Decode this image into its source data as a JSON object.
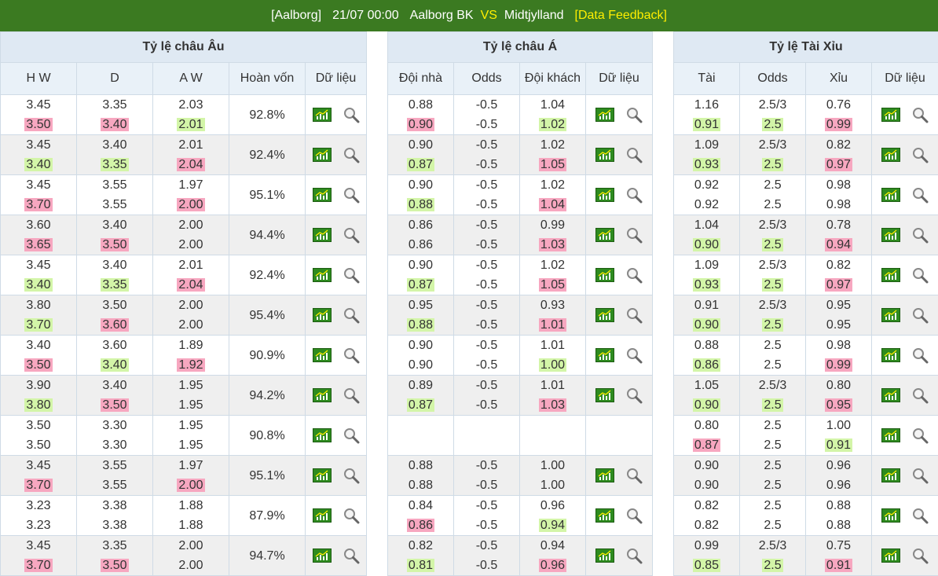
{
  "header": {
    "league": "[Aalborg]",
    "datetime": "21/07 00:00",
    "home": "Aalborg BK",
    "vs": "VS",
    "away": "Midtjylland",
    "feedback": "[Data Feedback]"
  },
  "colors": {
    "header_bg": "#3b7a21",
    "accent": "#ffee00",
    "up": "#f7a7c0",
    "down": "#d3f5a8"
  },
  "icons": {
    "chart": "chart-icon",
    "search": "search-icon"
  },
  "sections": [
    {
      "key": "eu",
      "title": "Tỷ lệ châu Âu",
      "columns": [
        "H W",
        "D",
        "A W",
        "Hoàn vốn",
        "Dữ liệu"
      ],
      "rows": [
        [
          [
            "3.45",
            "3.50",
            "r"
          ],
          [
            "3.35",
            "3.40",
            "r"
          ],
          [
            "2.03",
            "2.01",
            "g"
          ],
          [
            "92.8%"
          ]
        ],
        [
          [
            "3.45",
            "3.40",
            "g"
          ],
          [
            "3.40",
            "3.35",
            "g"
          ],
          [
            "2.01",
            "2.04",
            "r"
          ],
          [
            "92.4%"
          ]
        ],
        [
          [
            "3.45",
            "3.70",
            "r"
          ],
          [
            "3.55",
            "3.55",
            ""
          ],
          [
            "1.97",
            "2.00",
            "r"
          ],
          [
            "95.1%"
          ]
        ],
        [
          [
            "3.60",
            "3.65",
            "r"
          ],
          [
            "3.40",
            "3.50",
            "r"
          ],
          [
            "2.00",
            "2.00",
            ""
          ],
          [
            "94.4%"
          ]
        ],
        [
          [
            "3.45",
            "3.40",
            "g"
          ],
          [
            "3.40",
            "3.35",
            "g"
          ],
          [
            "2.01",
            "2.04",
            "r"
          ],
          [
            "92.4%"
          ]
        ],
        [
          [
            "3.80",
            "3.70",
            "g"
          ],
          [
            "3.50",
            "3.60",
            "r"
          ],
          [
            "2.00",
            "2.00",
            ""
          ],
          [
            "95.4%"
          ]
        ],
        [
          [
            "3.40",
            "3.50",
            "r"
          ],
          [
            "3.60",
            "3.40",
            "g"
          ],
          [
            "1.89",
            "1.92",
            "r"
          ],
          [
            "90.9%"
          ]
        ],
        [
          [
            "3.90",
            "3.80",
            "g"
          ],
          [
            "3.40",
            "3.50",
            "r"
          ],
          [
            "1.95",
            "1.95",
            ""
          ],
          [
            "94.2%"
          ]
        ],
        [
          [
            "3.50",
            "3.50",
            ""
          ],
          [
            "3.30",
            "3.30",
            ""
          ],
          [
            "1.95",
            "1.95",
            ""
          ],
          [
            "90.8%"
          ]
        ],
        [
          [
            "3.45",
            "3.70",
            "r"
          ],
          [
            "3.55",
            "3.55",
            ""
          ],
          [
            "1.97",
            "2.00",
            "r"
          ],
          [
            "95.1%"
          ]
        ],
        [
          [
            "3.23",
            "3.23",
            ""
          ],
          [
            "3.38",
            "3.38",
            ""
          ],
          [
            "1.88",
            "1.88",
            ""
          ],
          [
            "87.9%"
          ]
        ],
        [
          [
            "3.45",
            "3.70",
            "r"
          ],
          [
            "3.35",
            "3.50",
            "r"
          ],
          [
            "2.00",
            "2.00",
            ""
          ],
          [
            "94.7%"
          ]
        ]
      ]
    },
    {
      "key": "asia",
      "title": "Tỷ lệ châu Á",
      "columns": [
        "Đội nhà",
        "Odds",
        "Đội khách",
        "Dữ liệu"
      ],
      "rows": [
        [
          [
            "0.88",
            "0.90",
            "r"
          ],
          [
            "-0.5",
            "-0.5",
            ""
          ],
          [
            "1.04",
            "1.02",
            "g"
          ]
        ],
        [
          [
            "0.90",
            "0.87",
            "g"
          ],
          [
            "-0.5",
            "-0.5",
            ""
          ],
          [
            "1.02",
            "1.05",
            "r"
          ]
        ],
        [
          [
            "0.90",
            "0.88",
            "g"
          ],
          [
            "-0.5",
            "-0.5",
            ""
          ],
          [
            "1.02",
            "1.04",
            "r"
          ]
        ],
        [
          [
            "0.86",
            "0.86",
            ""
          ],
          [
            "-0.5",
            "-0.5",
            ""
          ],
          [
            "0.99",
            "1.03",
            "r"
          ]
        ],
        [
          [
            "0.90",
            "0.87",
            "g"
          ],
          [
            "-0.5",
            "-0.5",
            ""
          ],
          [
            "1.02",
            "1.05",
            "r"
          ]
        ],
        [
          [
            "0.95",
            "0.88",
            "g"
          ],
          [
            "-0.5",
            "-0.5",
            ""
          ],
          [
            "0.93",
            "1.01",
            "r"
          ]
        ],
        [
          [
            "0.90",
            "0.90",
            ""
          ],
          [
            "-0.5",
            "-0.5",
            ""
          ],
          [
            "1.01",
            "1.00",
            "g"
          ]
        ],
        [
          [
            "0.89",
            "0.87",
            "g"
          ],
          [
            "-0.5",
            "-0.5",
            ""
          ],
          [
            "1.01",
            "1.03",
            "r"
          ]
        ],
        null,
        [
          [
            "0.88",
            "0.88",
            ""
          ],
          [
            "-0.5",
            "-0.5",
            ""
          ],
          [
            "1.00",
            "1.00",
            ""
          ]
        ],
        [
          [
            "0.84",
            "0.86",
            "r"
          ],
          [
            "-0.5",
            "-0.5",
            ""
          ],
          [
            "0.96",
            "0.94",
            "g"
          ]
        ],
        [
          [
            "0.82",
            "0.81",
            "g"
          ],
          [
            "-0.5",
            "-0.5",
            ""
          ],
          [
            "0.94",
            "0.96",
            "r"
          ]
        ]
      ]
    },
    {
      "key": "ou",
      "title": "Tỷ lệ Tài Xỉu",
      "columns": [
        "Tài",
        "Odds",
        "Xỉu",
        "Dữ liệu"
      ],
      "rows": [
        [
          [
            "1.16",
            "0.91",
            "g"
          ],
          [
            "2.5/3",
            "2.5",
            "g"
          ],
          [
            "0.76",
            "0.99",
            "r"
          ]
        ],
        [
          [
            "1.09",
            "0.93",
            "g"
          ],
          [
            "2.5/3",
            "2.5",
            "g"
          ],
          [
            "0.82",
            "0.97",
            "r"
          ]
        ],
        [
          [
            "0.92",
            "0.92",
            ""
          ],
          [
            "2.5",
            "2.5",
            ""
          ],
          [
            "0.98",
            "0.98",
            ""
          ]
        ],
        [
          [
            "1.04",
            "0.90",
            "g"
          ],
          [
            "2.5/3",
            "2.5",
            "g"
          ],
          [
            "0.78",
            "0.94",
            "r"
          ]
        ],
        [
          [
            "1.09",
            "0.93",
            "g"
          ],
          [
            "2.5/3",
            "2.5",
            "g"
          ],
          [
            "0.82",
            "0.97",
            "r"
          ]
        ],
        [
          [
            "0.91",
            "0.90",
            "g"
          ],
          [
            "2.5/3",
            "2.5",
            "g"
          ],
          [
            "0.95",
            "0.95",
            ""
          ]
        ],
        [
          [
            "0.88",
            "0.86",
            "g"
          ],
          [
            "2.5",
            "2.5",
            ""
          ],
          [
            "0.98",
            "0.99",
            "r"
          ]
        ],
        [
          [
            "1.05",
            "0.90",
            "g"
          ],
          [
            "2.5/3",
            "2.5",
            "g"
          ],
          [
            "0.80",
            "0.95",
            "r"
          ]
        ],
        [
          [
            "0.80",
            "0.87",
            "r"
          ],
          [
            "2.5",
            "2.5",
            ""
          ],
          [
            "1.00",
            "0.91",
            "g"
          ]
        ],
        [
          [
            "0.90",
            "0.90",
            ""
          ],
          [
            "2.5",
            "2.5",
            ""
          ],
          [
            "0.96",
            "0.96",
            ""
          ]
        ],
        [
          [
            "0.82",
            "0.82",
            ""
          ],
          [
            "2.5",
            "2.5",
            ""
          ],
          [
            "0.88",
            "0.88",
            ""
          ]
        ],
        [
          [
            "0.99",
            "0.85",
            "g"
          ],
          [
            "2.5/3",
            "2.5",
            "g"
          ],
          [
            "0.75",
            "0.91",
            "r"
          ]
        ]
      ]
    }
  ]
}
